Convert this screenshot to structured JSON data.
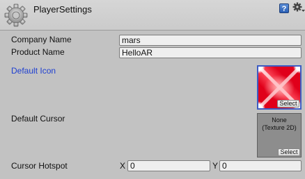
{
  "header": {
    "title": "PlayerSettings",
    "help_icon": "help-icon",
    "help_glyph": "?",
    "menu_icon": "settings-menu-icon"
  },
  "fields": {
    "company_name": {
      "label": "Company Name",
      "value": "mars"
    },
    "product_name": {
      "label": "Product Name",
      "value": "HelloAR"
    },
    "default_icon": {
      "label": "Default Icon",
      "select_label": "Select"
    },
    "default_cursor": {
      "label": "Default Cursor",
      "none_text": "None\n(Texture 2D)",
      "select_label": "Select"
    },
    "cursor_hotspot": {
      "label": "Cursor Hotspot",
      "x_label": "X",
      "x_value": "0",
      "y_label": "Y",
      "y_value": "0"
    }
  },
  "colors": {
    "link_label": "#1e3fd1",
    "selected_border": "#3d5cc3",
    "icon_texture": "#e8001c"
  }
}
